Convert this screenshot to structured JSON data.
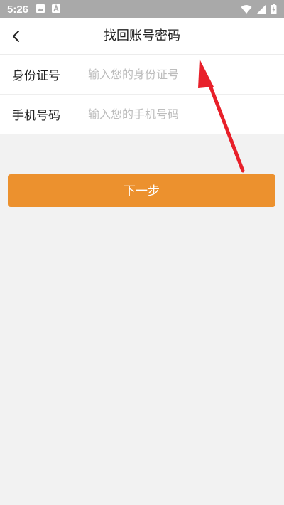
{
  "status_bar": {
    "time": "5:26",
    "icons": [
      "image-icon",
      "a-icon",
      "wifi-icon",
      "signal-icon",
      "battery-icon"
    ]
  },
  "header": {
    "title": "找回账号密码",
    "back_icon": "chevron-left-icon"
  },
  "form": {
    "id_label": "身份证号",
    "id_placeholder": "输入您的身份证号",
    "phone_label": "手机号码",
    "phone_placeholder": "输入您的手机号码"
  },
  "actions": {
    "next_label": "下一步"
  },
  "colors": {
    "accent": "#ec912e",
    "annotation": "#e8202a"
  }
}
